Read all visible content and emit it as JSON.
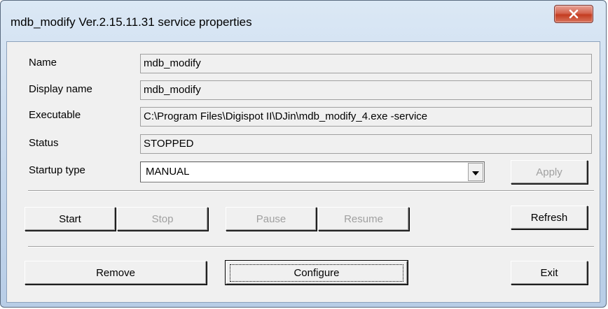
{
  "window": {
    "title": "mdb_modify Ver.2.15.11.31 service properties"
  },
  "fields": [
    {
      "label": "Name",
      "value": "mdb_modify"
    },
    {
      "label": "Display name",
      "value": "mdb_modify"
    },
    {
      "label": "Executable",
      "value": "C:\\Program Files\\Digispot II\\DJin\\mdb_modify_4.exe -service"
    },
    {
      "label": "Status",
      "value": "STOPPED"
    }
  ],
  "startup": {
    "label": "Startup type",
    "selected": "MANUAL",
    "apply_label": "Apply"
  },
  "controls": {
    "start": "Start",
    "stop": "Stop",
    "pause": "Pause",
    "resume": "Resume",
    "refresh": "Refresh"
  },
  "actions": {
    "remove": "Remove",
    "configure": "Configure",
    "exit": "Exit"
  },
  "colors": {
    "close_button": "#c43c21",
    "disabled_text": "#a0a0a0",
    "dialog_background": "#f0f0f0"
  },
  "icons": {
    "close": "close-icon",
    "dropdown": "chevron-down-icon"
  }
}
